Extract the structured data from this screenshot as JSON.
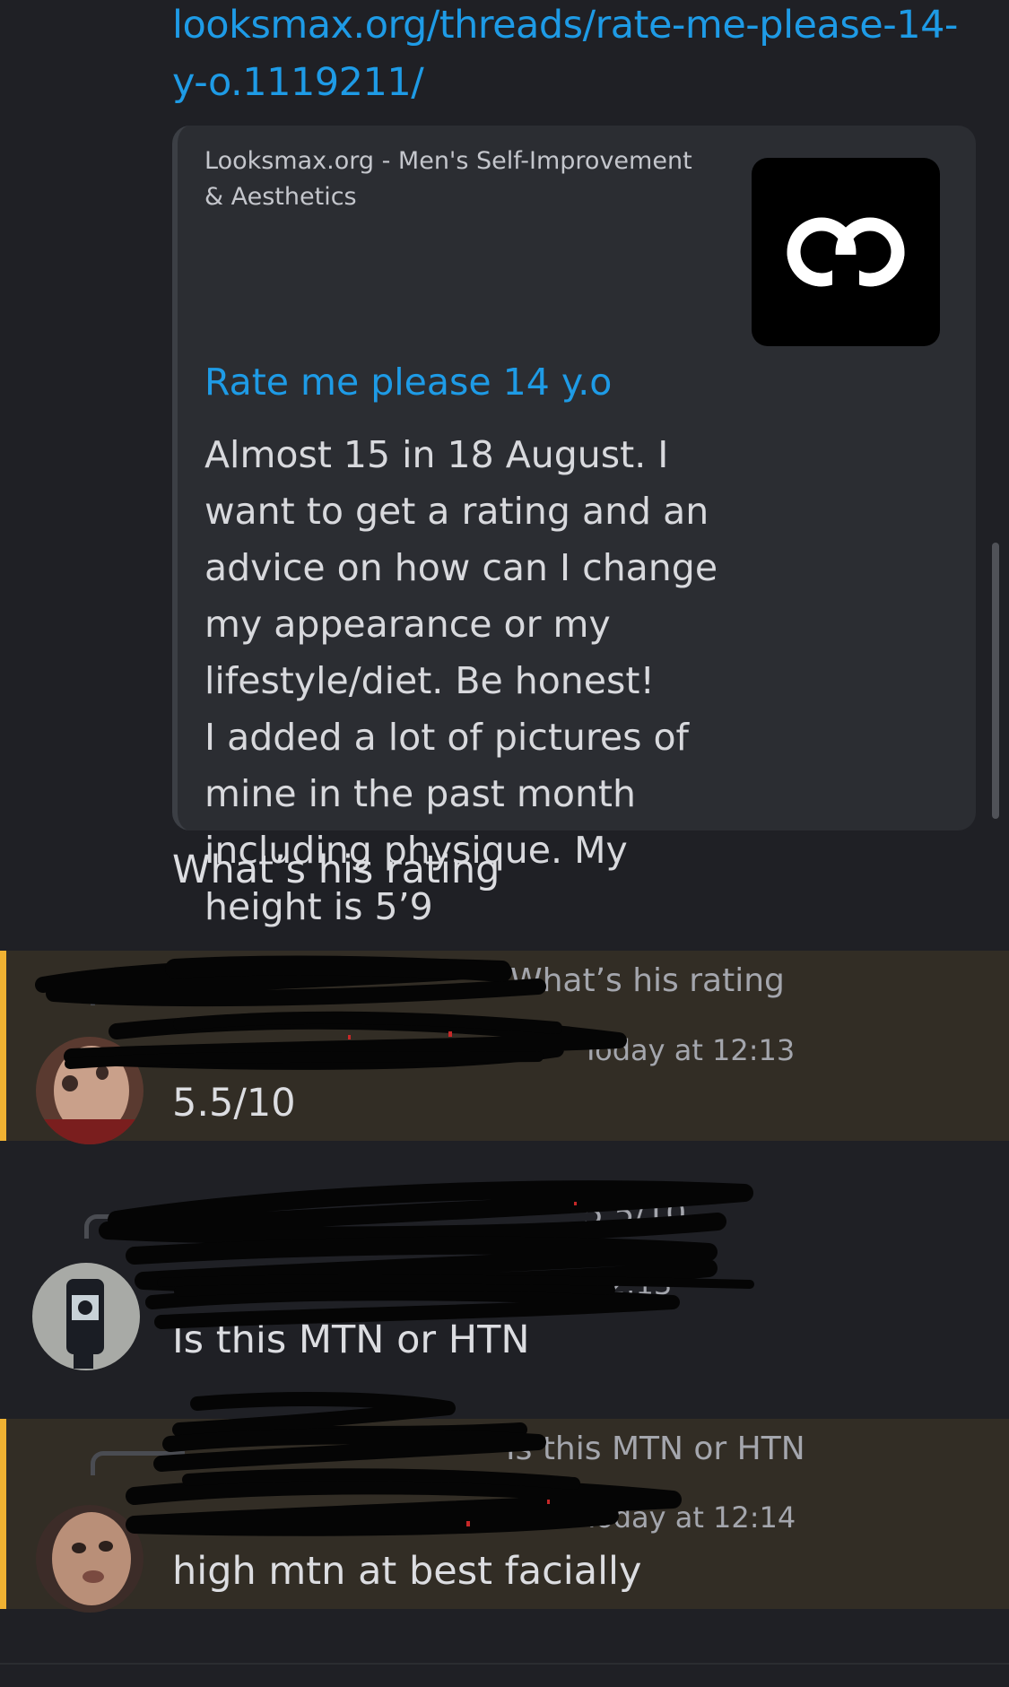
{
  "link": {
    "url_text": "looksmax.org/threads/rate-me-please-14-y-o.1119211/"
  },
  "embed": {
    "provider": "Looksmax.org - Men's Self-Improvement & Aesthetics",
    "title": "Rate me please 14 y.o",
    "description": "Almost 15 in 18 August. I want to get a rating and an advice on how can I change my appearance or my lifestyle/diet. Be honest!\nI added a lot of pictures of mine in the past month including physique. My height is 5’9",
    "thumbnail_icon": "looksmax-logo-icon"
  },
  "first_message": {
    "text": "What’s his rating"
  },
  "messages": [
    {
      "reply_preview": "What’s his rating",
      "timestamp": "Today at 12:13",
      "text": "5.5/10",
      "highlighted": true
    },
    {
      "reply_preview": "5.5/10",
      "timestamp": "Today at 12:13",
      "text": "Is this MTN or HTN",
      "highlighted": false
    },
    {
      "reply_preview": "Is this MTN or HTN",
      "timestamp": "Today at 12:14",
      "text": "high mtn at best facially",
      "highlighted": true
    }
  ],
  "colors": {
    "background": "#1f2025",
    "link": "#1e9be6",
    "mention_highlight": "#322d25",
    "mention_bar": "#f0b232",
    "embed_bg": "#2b2d32"
  }
}
